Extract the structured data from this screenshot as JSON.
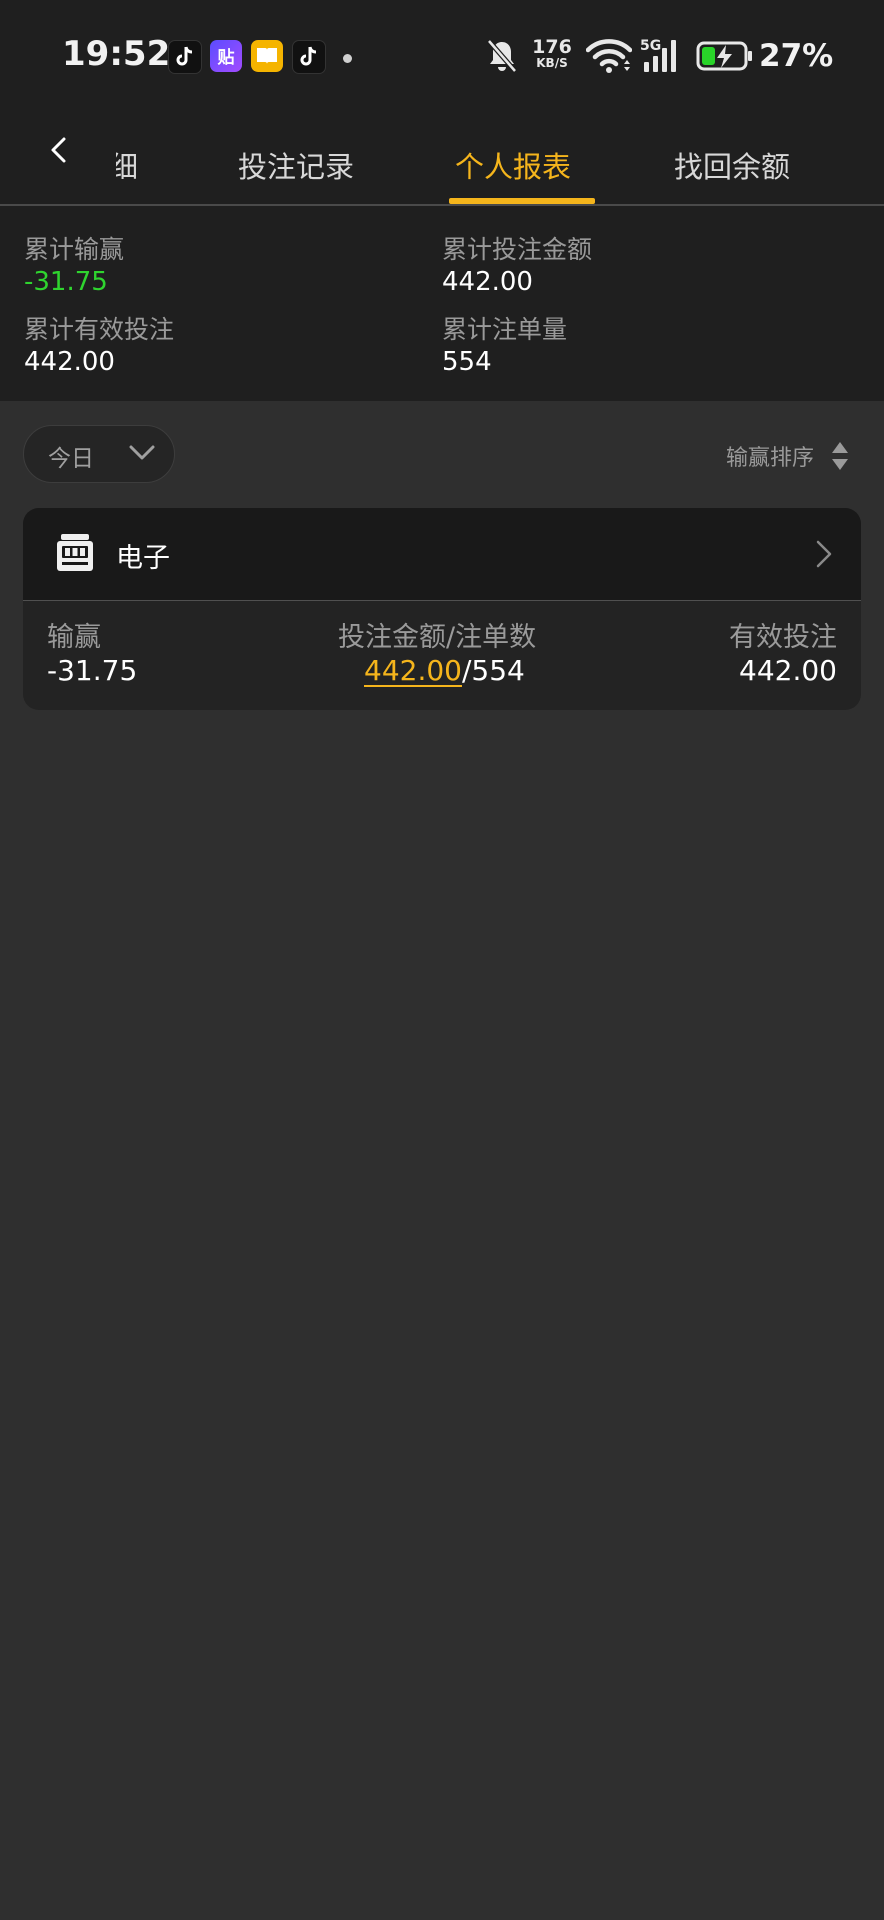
{
  "status_bar": {
    "time": "19:52",
    "net_speed_value": "176",
    "net_speed_unit": "KB/S",
    "battery_percent": "27%"
  },
  "nav": {
    "tabs": [
      {
        "label": "明细",
        "active": false
      },
      {
        "label": "投注记录",
        "active": false
      },
      {
        "label": "个人报表",
        "active": true
      },
      {
        "label": "找回余额",
        "active": false
      }
    ],
    "accent_color": "#f5b51c"
  },
  "summary": {
    "total_win_loss_label": "累计输赢",
    "total_win_loss_value": "-31.75",
    "total_bet_amount_label": "累计投注金额",
    "total_bet_amount_value": "442.00",
    "total_valid_bet_label": "累计有效投注",
    "total_valid_bet_value": "442.00",
    "total_order_count_label": "累计注单量",
    "total_order_count_value": "554"
  },
  "filters": {
    "date_range_selected": "今日",
    "sort_label": "输赢排序"
  },
  "category_card": {
    "icon": "slot-machine-icon",
    "title": "电子",
    "win_loss_label": "输赢",
    "win_loss_value": "-31.75",
    "bet_amount_label": "投注金额/注单数",
    "bet_amount_value": "442.00",
    "separator": "/",
    "order_count_value": "554",
    "valid_bet_label": "有效投注",
    "valid_bet_value": "442.00"
  },
  "colors": {
    "positive_green": "#2fd42f",
    "accent_gold": "#f5b51c"
  }
}
